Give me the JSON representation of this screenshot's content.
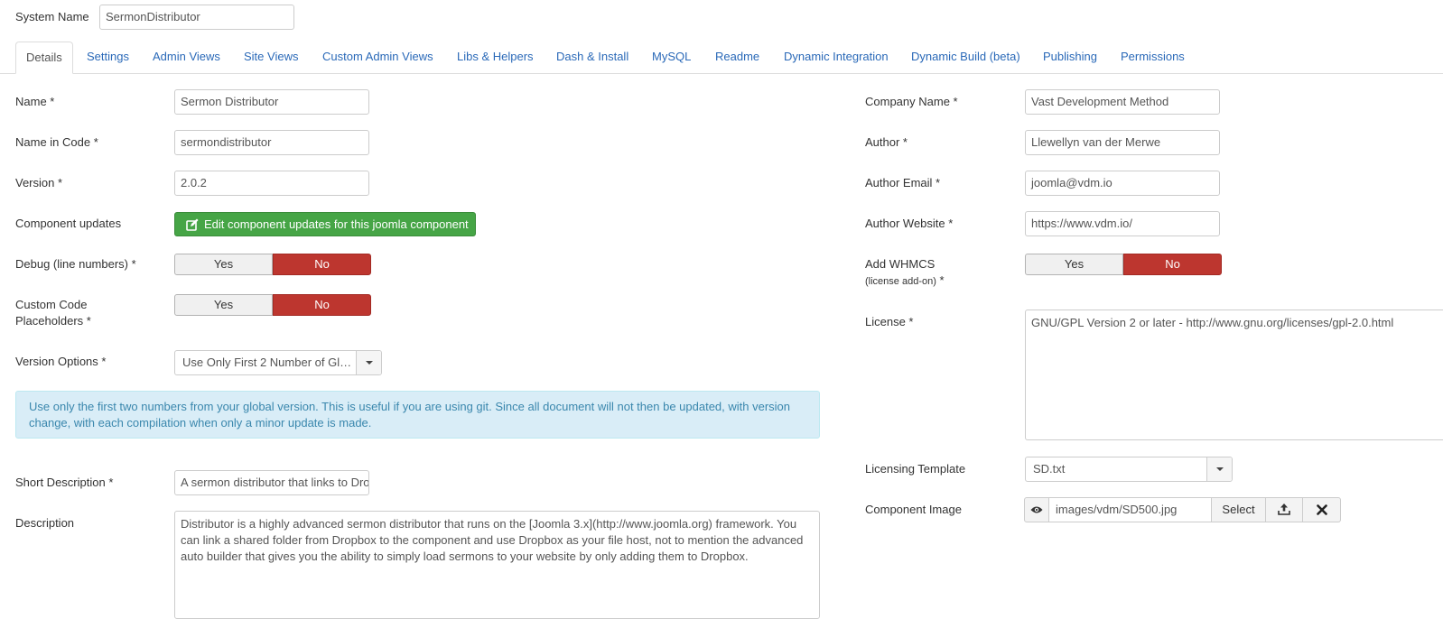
{
  "system_name": {
    "label": "System Name",
    "value": "SermonDistributor"
  },
  "tabs": [
    {
      "label": "Details"
    },
    {
      "label": "Settings"
    },
    {
      "label": "Admin Views"
    },
    {
      "label": "Site Views"
    },
    {
      "label": "Custom Admin Views"
    },
    {
      "label": "Libs & Helpers"
    },
    {
      "label": "Dash & Install"
    },
    {
      "label": "MySQL"
    },
    {
      "label": "Readme"
    },
    {
      "label": "Dynamic Integration"
    },
    {
      "label": "Dynamic Build (beta)"
    },
    {
      "label": "Publishing"
    },
    {
      "label": "Permissions"
    }
  ],
  "left": {
    "name": {
      "label": "Name *",
      "value": "Sermon Distributor"
    },
    "name_in_code": {
      "label": "Name in Code *",
      "value": "sermondistributor"
    },
    "version": {
      "label": "Version *",
      "value": "2.0.2"
    },
    "component_updates": {
      "label": "Component updates",
      "button": "Edit component updates for this joomla component"
    },
    "debug": {
      "label": "Debug (line numbers) *",
      "yes": "Yes",
      "no": "No",
      "selected": "No"
    },
    "custom_code": {
      "label_line1": "Custom Code",
      "label_line2": "Placeholders *",
      "yes": "Yes",
      "no": "No",
      "selected": "No"
    },
    "version_options": {
      "label": "Version Options *",
      "value": "Use Only First 2 Number of Glo…"
    },
    "info": "Use only the first two numbers from your global version. This is useful if you are using git. Since all document will not then be updated, with version change, with each compilation when only a minor update is made.",
    "short_description": {
      "label": "Short Description *",
      "value": "A sermon distributor that links to Dropbox."
    },
    "description": {
      "label": "Description",
      "value": "Distributor is a highly advanced sermon distributor that runs on the [Joomla 3.x](http://www.joomla.org) framework. You can link a shared folder from Dropbox to the component and use Dropbox as your file host, not to mention the advanced auto builder that gives you the ability to simply load sermons to your website by only adding them to Dropbox."
    }
  },
  "right": {
    "company_name": {
      "label": "Company Name *",
      "value": "Vast Development Method"
    },
    "author": {
      "label": "Author *",
      "value": "Llewellyn van der Merwe"
    },
    "author_email": {
      "label": "Author Email *",
      "value": "joomla@vdm.io"
    },
    "author_website": {
      "label": "Author Website *",
      "value": "https://www.vdm.io/"
    },
    "whmcs": {
      "label_line1": "Add WHMCS",
      "label_line2": "(license add-on)",
      "required": " *",
      "yes": "Yes",
      "no": "No",
      "selected": "No"
    },
    "license": {
      "label": "License *",
      "value": "GNU/GPL Version 2 or later - http://www.gnu.org/licenses/gpl-2.0.html"
    },
    "licensing_template": {
      "label": "Licensing Template",
      "value": "SD.txt"
    },
    "component_image": {
      "label": "Component Image",
      "value": "images/vdm/SD500.jpg",
      "select": "Select"
    }
  },
  "colors": {
    "accent": "#2a69b8",
    "success": "#46a546",
    "danger": "#bd362f",
    "info_bg": "#d9edf7",
    "info_text": "#3a87ad"
  }
}
